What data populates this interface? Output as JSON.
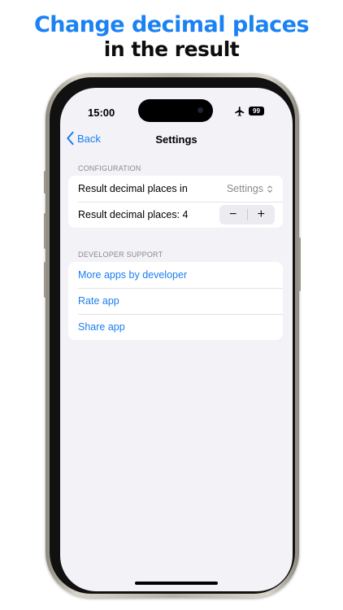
{
  "headline": {
    "line1": "Change decimal places",
    "line2": "in the result"
  },
  "colors": {
    "accent": "#1a7ef0",
    "headline_accent": "#1a82f2",
    "background": "#f2f2f7"
  },
  "status_bar": {
    "time": "15:00",
    "battery": "99",
    "airplane_icon": "airplane-icon"
  },
  "nav": {
    "back_label": "Back",
    "title": "Settings"
  },
  "configuration": {
    "header": "CONFIGURATION",
    "decimal_places_in_label": "Result decimal places in",
    "decimal_places_in_value": "Settings",
    "decimal_places_label": "Result decimal places: 4",
    "decrement_glyph": "−",
    "increment_glyph": "+"
  },
  "developer_support": {
    "header": "DEVELOPER SUPPORT",
    "items": [
      "More apps by developer",
      "Rate app",
      "Share app"
    ]
  }
}
